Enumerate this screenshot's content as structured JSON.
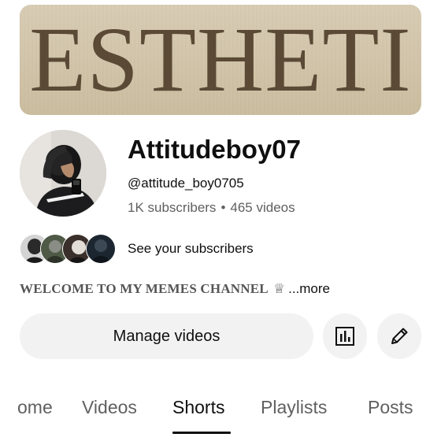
{
  "banner": {
    "text": "ESTHETI"
  },
  "channel": {
    "name": "Attitudeboy07",
    "handle": "@attitude_boy0705",
    "subscribers": "1K subscribers",
    "separator": "•",
    "videos": "465 videos"
  },
  "subscribers_row": {
    "label": "See your subscribers"
  },
  "description": {
    "text": "WELCOME TO MY MEMES CHANNEL",
    "crown": "♕",
    "more": "...more"
  },
  "actions": {
    "manage_label": "Manage videos",
    "analytics_icon": "analytics-icon",
    "edit_icon": "pencil-icon"
  },
  "tabs": [
    {
      "label": "ome",
      "active": false
    },
    {
      "label": "Videos",
      "active": false
    },
    {
      "label": "Shorts",
      "active": true
    },
    {
      "label": "Playlists",
      "active": false
    },
    {
      "label": "Posts",
      "active": false
    }
  ]
}
